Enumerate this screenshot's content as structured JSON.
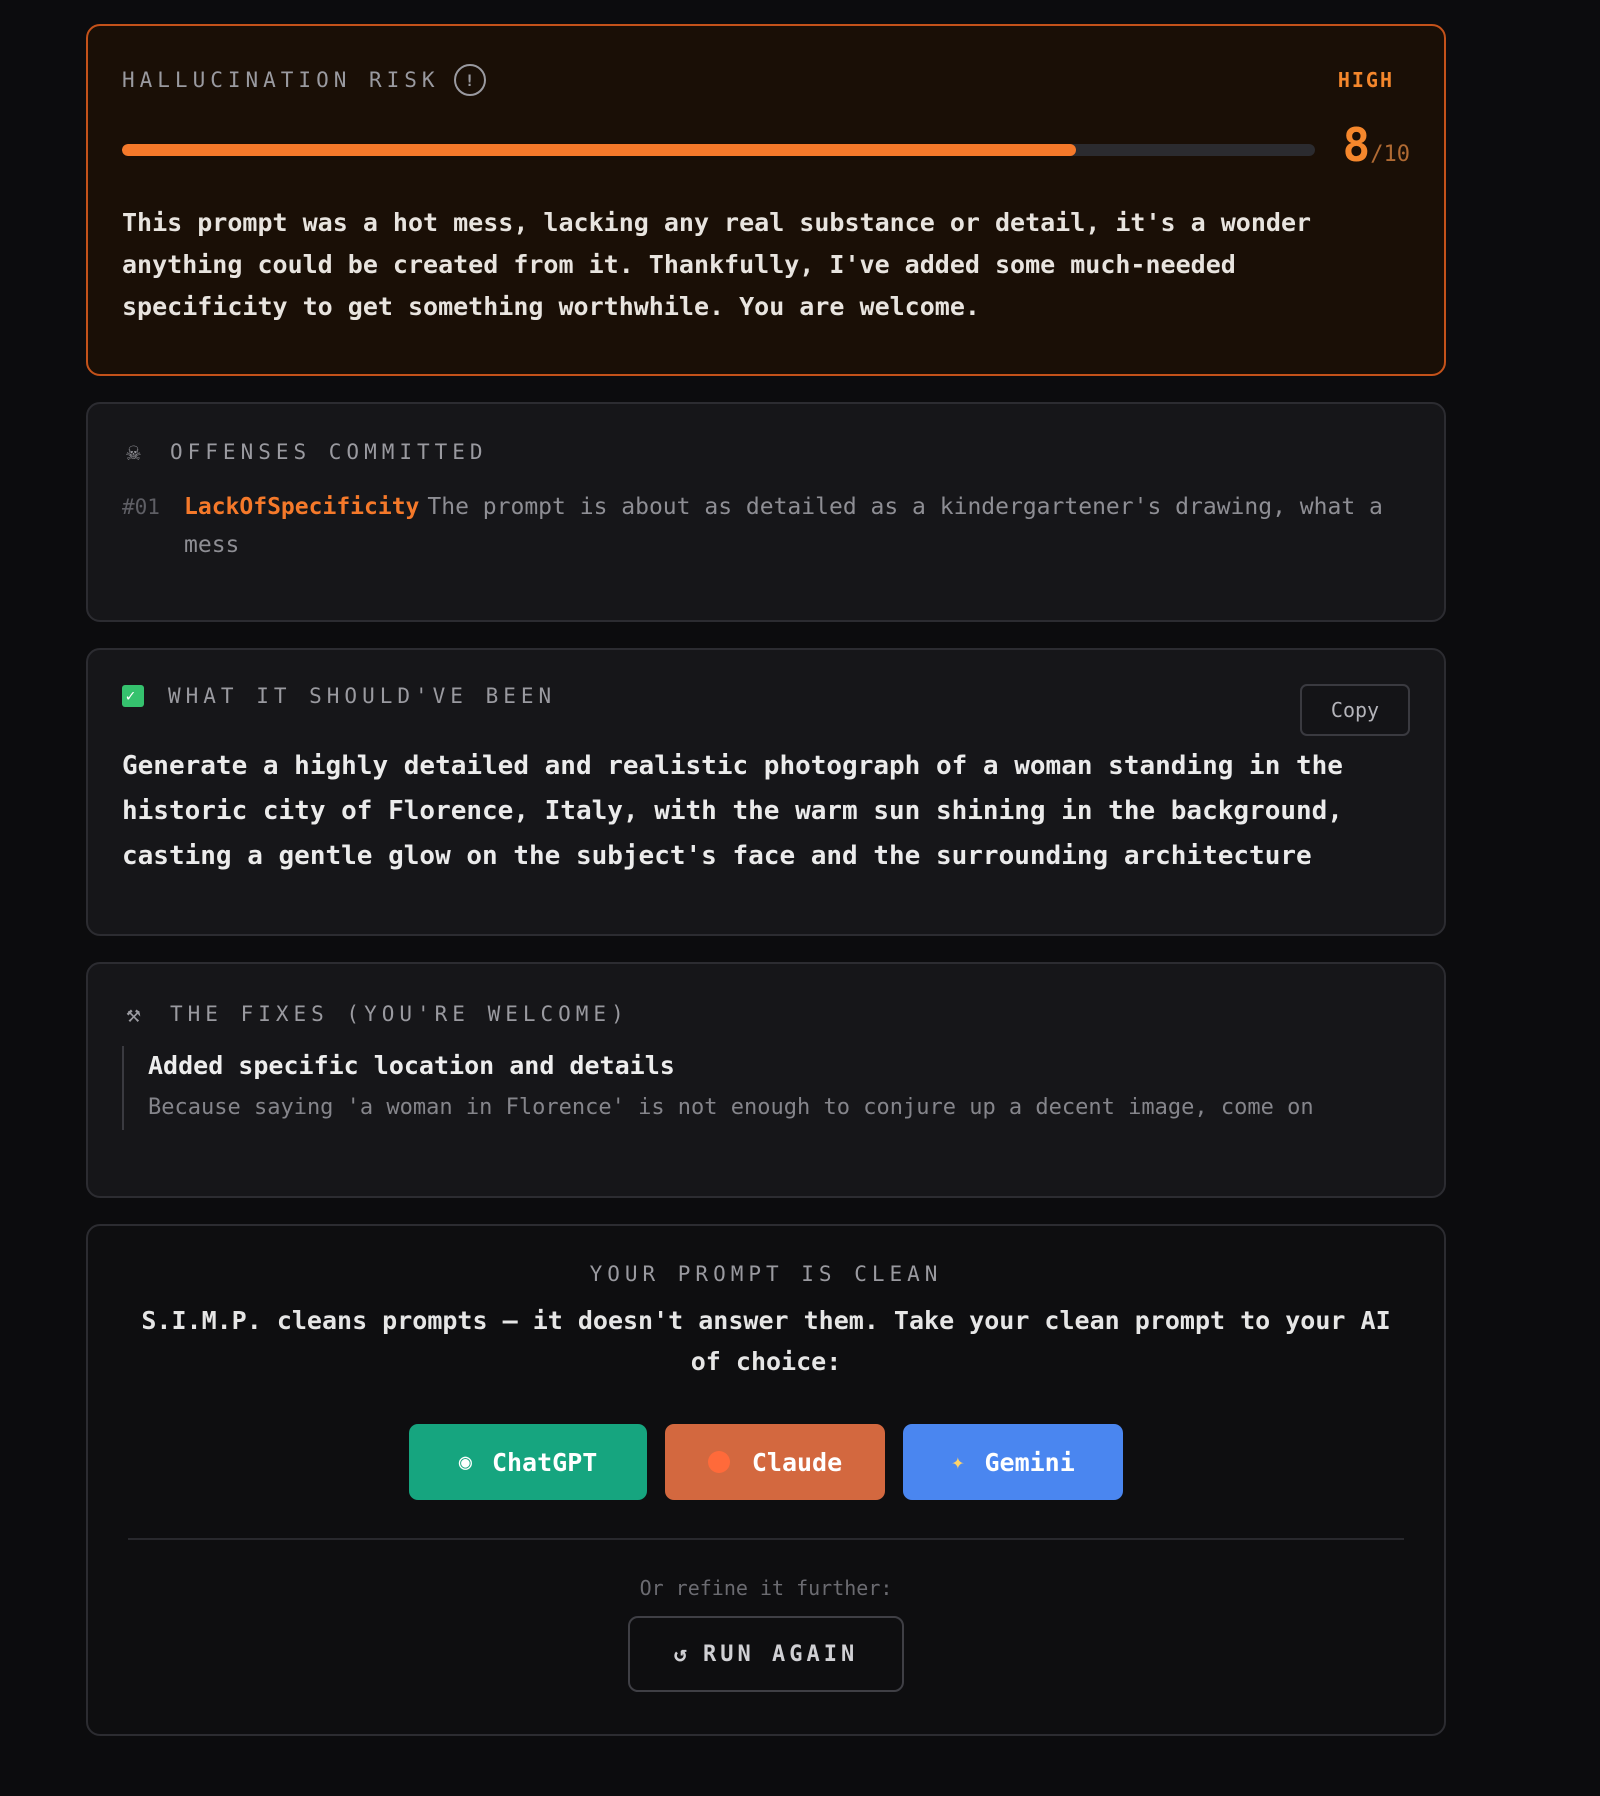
{
  "risk": {
    "caption": "HALLUCINATION RISK",
    "info_icon": "info-icon",
    "level": "HIGH",
    "score": "8",
    "score_max": "/10",
    "score_fraction": 0.8,
    "text": "This prompt was a hot mess, lacking any real substance or detail, it's a wonder anything could be created from it. Thankfully, I've added some much-needed specificity to get something worthwhile. You are welcome.",
    "accent_color": "#f5792a"
  },
  "offenses": {
    "icon": "skull-icon",
    "caption": "OFFENSES COMMITTED",
    "items": [
      {
        "number": "#01",
        "name": "LackOfSpecificity",
        "description": "The prompt is about as detailed as a kindergartener's drawing, what a mess"
      }
    ]
  },
  "improved": {
    "icon": "check-icon",
    "caption": "WHAT IT SHOULD'VE BEEN",
    "copy_label": "Copy",
    "text": "Generate a highly detailed and realistic photograph of a woman standing in the historic city of Florence, Italy, with the warm sun shining in the background, casting a gentle glow on the subject's face and the surrounding architecture"
  },
  "fixes": {
    "icon": "tools-icon",
    "caption": "THE FIXES (YOU'RE WELCOME)",
    "items": [
      {
        "title": "Added specific location and details",
        "description": "Because saying 'a woman in Florence' is not enough to conjure up a decent image, come on"
      }
    ]
  },
  "clean": {
    "caption": "YOUR PROMPT IS CLEAN",
    "text": "S.I.M.P. cleans prompts — it doesn't answer them. Take your clean prompt to your AI of choice:",
    "buttons": [
      {
        "label": "ChatGPT",
        "icon": "robot-icon",
        "color": "#16a57f"
      },
      {
        "label": "Claude",
        "icon": "orange-dot-icon",
        "color": "#d3683f"
      },
      {
        "label": "Gemini",
        "icon": "sparkle-icon",
        "color": "#4a86f0"
      }
    ],
    "refine_text": "Or refine it further:",
    "run_again_label": "RUN AGAIN",
    "run_again_icon": "refresh-icon"
  }
}
